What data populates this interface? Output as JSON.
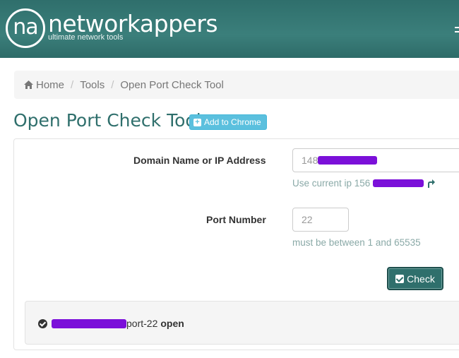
{
  "header": {
    "logo_mark": "na",
    "brand": "networkappers",
    "tagline": "ultimate network tools"
  },
  "breadcrumb": {
    "home": "Home",
    "tools": "Tools",
    "current": "Open Port Check Tool"
  },
  "page": {
    "title": "Open Port Check Tool",
    "add_to_chrome": "Add to Chrome"
  },
  "form": {
    "domain_label": "Domain Name or IP Address",
    "domain_value_prefix": "148",
    "use_current_ip": "Use current ip 156",
    "port_label": "Port Number",
    "port_value": "22",
    "port_help": "must be between 1 and 65535",
    "check_label": "Check"
  },
  "result": {
    "port_text": "port-22",
    "status": "open"
  },
  "colors": {
    "brand_teal": "#2f6f6c",
    "info_button": "#5bc0de",
    "redaction": "#7b10d9"
  },
  "icons": [
    "home-icon",
    "plus-square-icon",
    "reuse-arrow-icon",
    "check-square-icon",
    "check-circle-icon",
    "menu-icon"
  ]
}
